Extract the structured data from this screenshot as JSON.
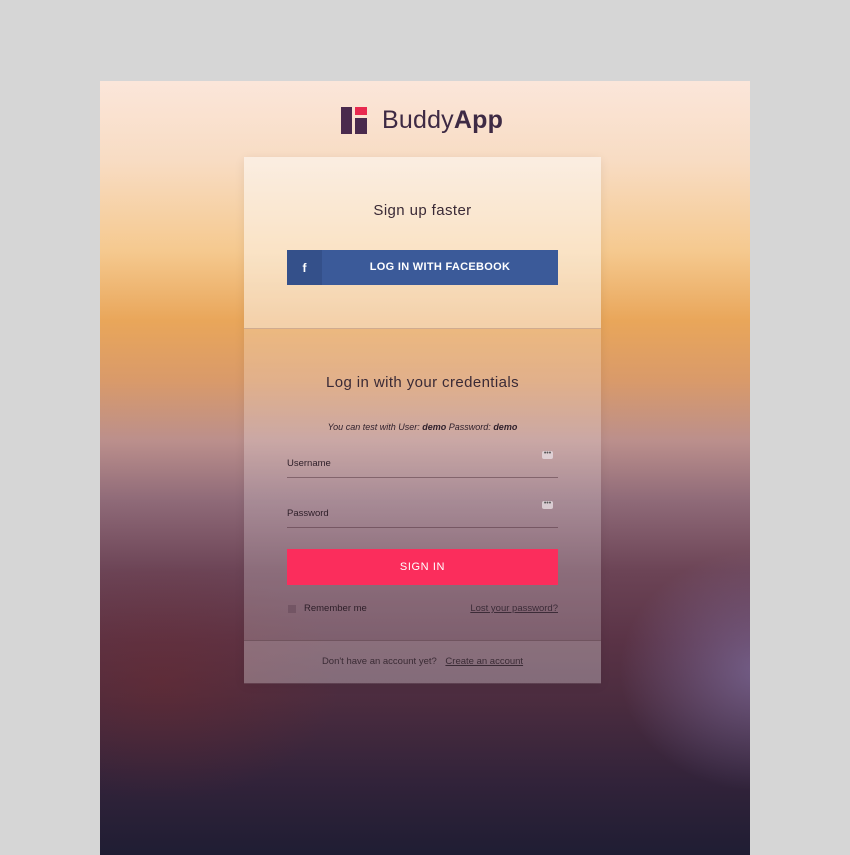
{
  "brand": {
    "name_light": "Buddy",
    "name_bold": "App",
    "mark_colors": {
      "primary": "#4a2a4d",
      "accent": "#e8294f"
    }
  },
  "signup": {
    "title": "Sign up faster",
    "facebook_icon": "f",
    "facebook_label": "LOG IN WITH FACEBOOK",
    "facebook_color": "#3b5a99"
  },
  "login": {
    "title": "Log in with your credentials",
    "hint_prefix": "You can test with User:",
    "hint_user": "demo",
    "hint_password_label": "Password:",
    "hint_password": "demo",
    "username_label": "Username",
    "password_label": "Password",
    "field_icon": "key-icon",
    "signin_label": "SIGN IN",
    "signin_color": "#fb2d5c",
    "remember_label": "Remember me",
    "lost_password": "Lost your password?"
  },
  "footer": {
    "no_account": "Don't have an account yet?",
    "create_account": "Create an account"
  }
}
